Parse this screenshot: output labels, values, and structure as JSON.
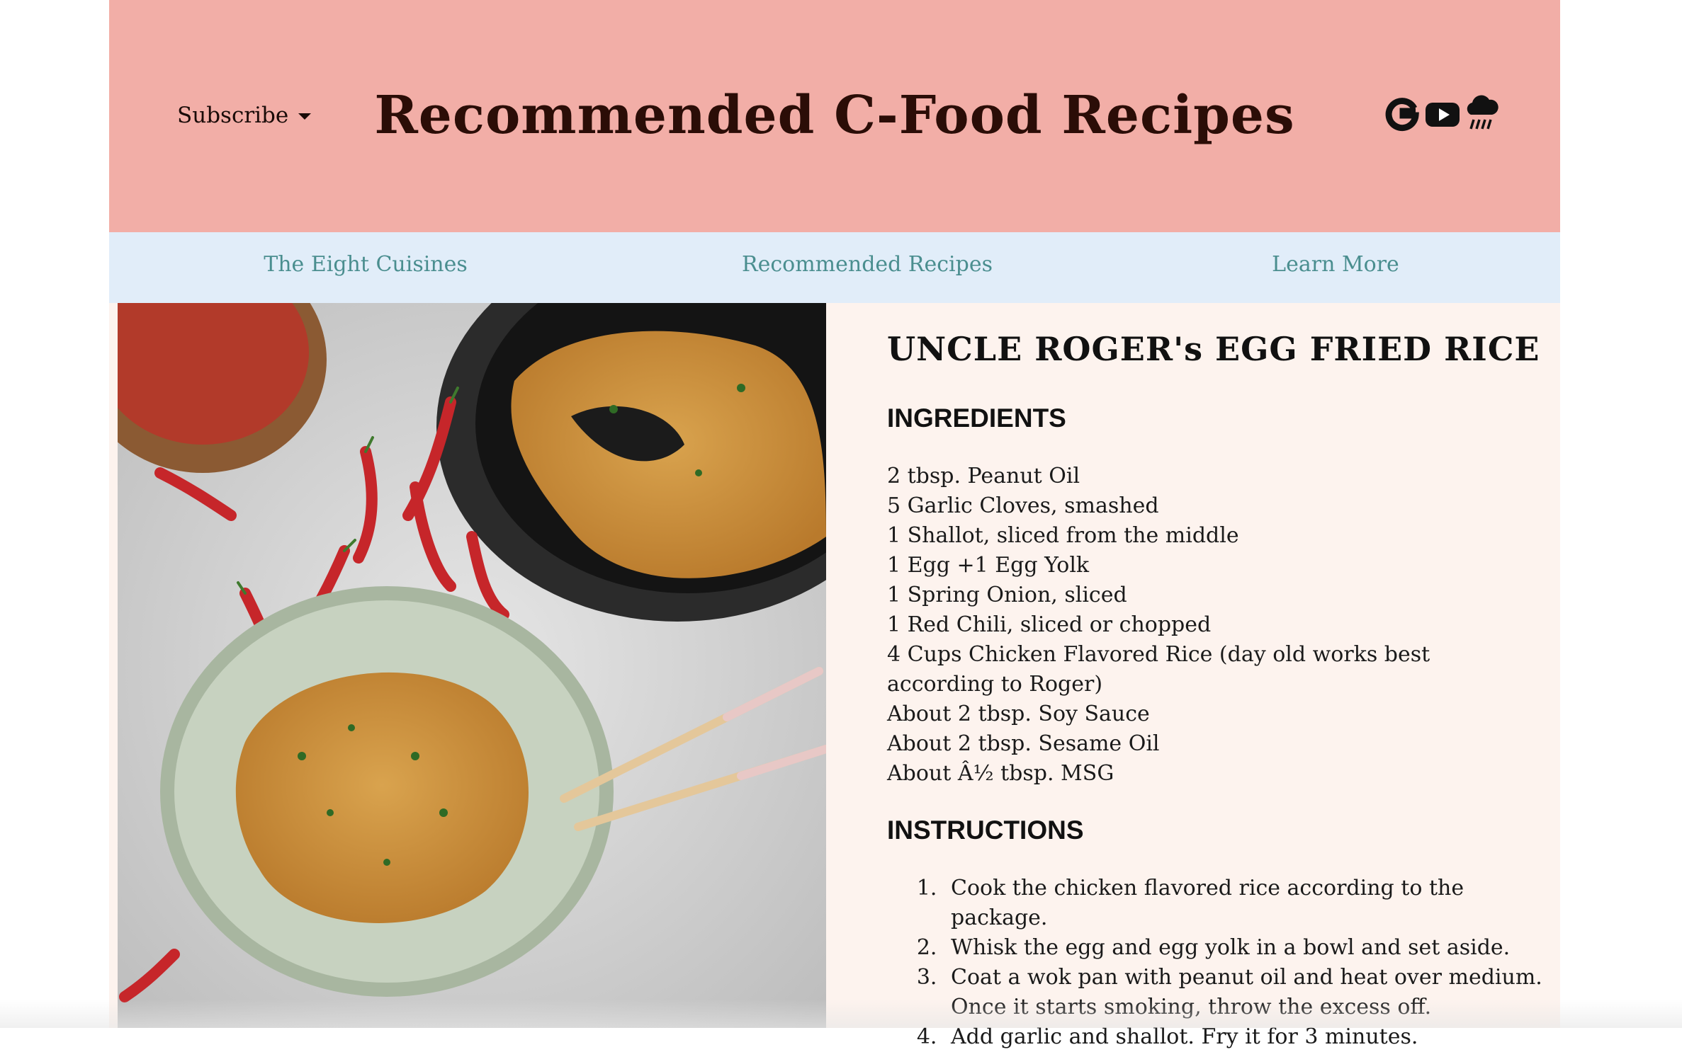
{
  "header": {
    "subscribe_label": "Subscribe",
    "site_title": "Recommended C-Food Recipes",
    "social_icons": [
      "google-icon",
      "youtube-icon",
      "weather-cloud-rain-icon"
    ],
    "background_color": "#f2aea7"
  },
  "nav": {
    "items": [
      {
        "label": "The Eight Cuisines"
      },
      {
        "label": "Recommended Recipes"
      },
      {
        "label": "Learn More"
      }
    ],
    "link_color": "#4a8e8f",
    "background_color": "#e1edf9"
  },
  "recipe": {
    "title": "UNCLE ROGER's EGG FRIED RICE",
    "ingredients_heading": "INGREDIENTS",
    "ingredients": [
      "2 tbsp. Peanut Oil",
      "5 Garlic Cloves, smashed",
      "1 Shallot, sliced from the middle",
      "1 Egg +1 Egg Yolk",
      "1 Spring Onion, sliced",
      "1 Red Chili, sliced or chopped",
      "4 Cups Chicken Flavored Rice (day old works best according to Roger)",
      "About 2 tbsp. Soy Sauce",
      "About 2 tbsp. Sesame Oil",
      "About Â½ tbsp. MSG"
    ],
    "instructions_heading": "INSTRUCTIONS",
    "instructions": [
      "Cook the chicken flavored rice according to the package.",
      "Whisk the egg and egg yolk in a bowl and set aside.",
      "Coat a wok pan with peanut oil and heat over medium. Once it starts smoking, throw the excess off.",
      "Add garlic and shallot. Fry it for 3 minutes."
    ],
    "photo_icon": "egg-fried-rice-photo"
  }
}
